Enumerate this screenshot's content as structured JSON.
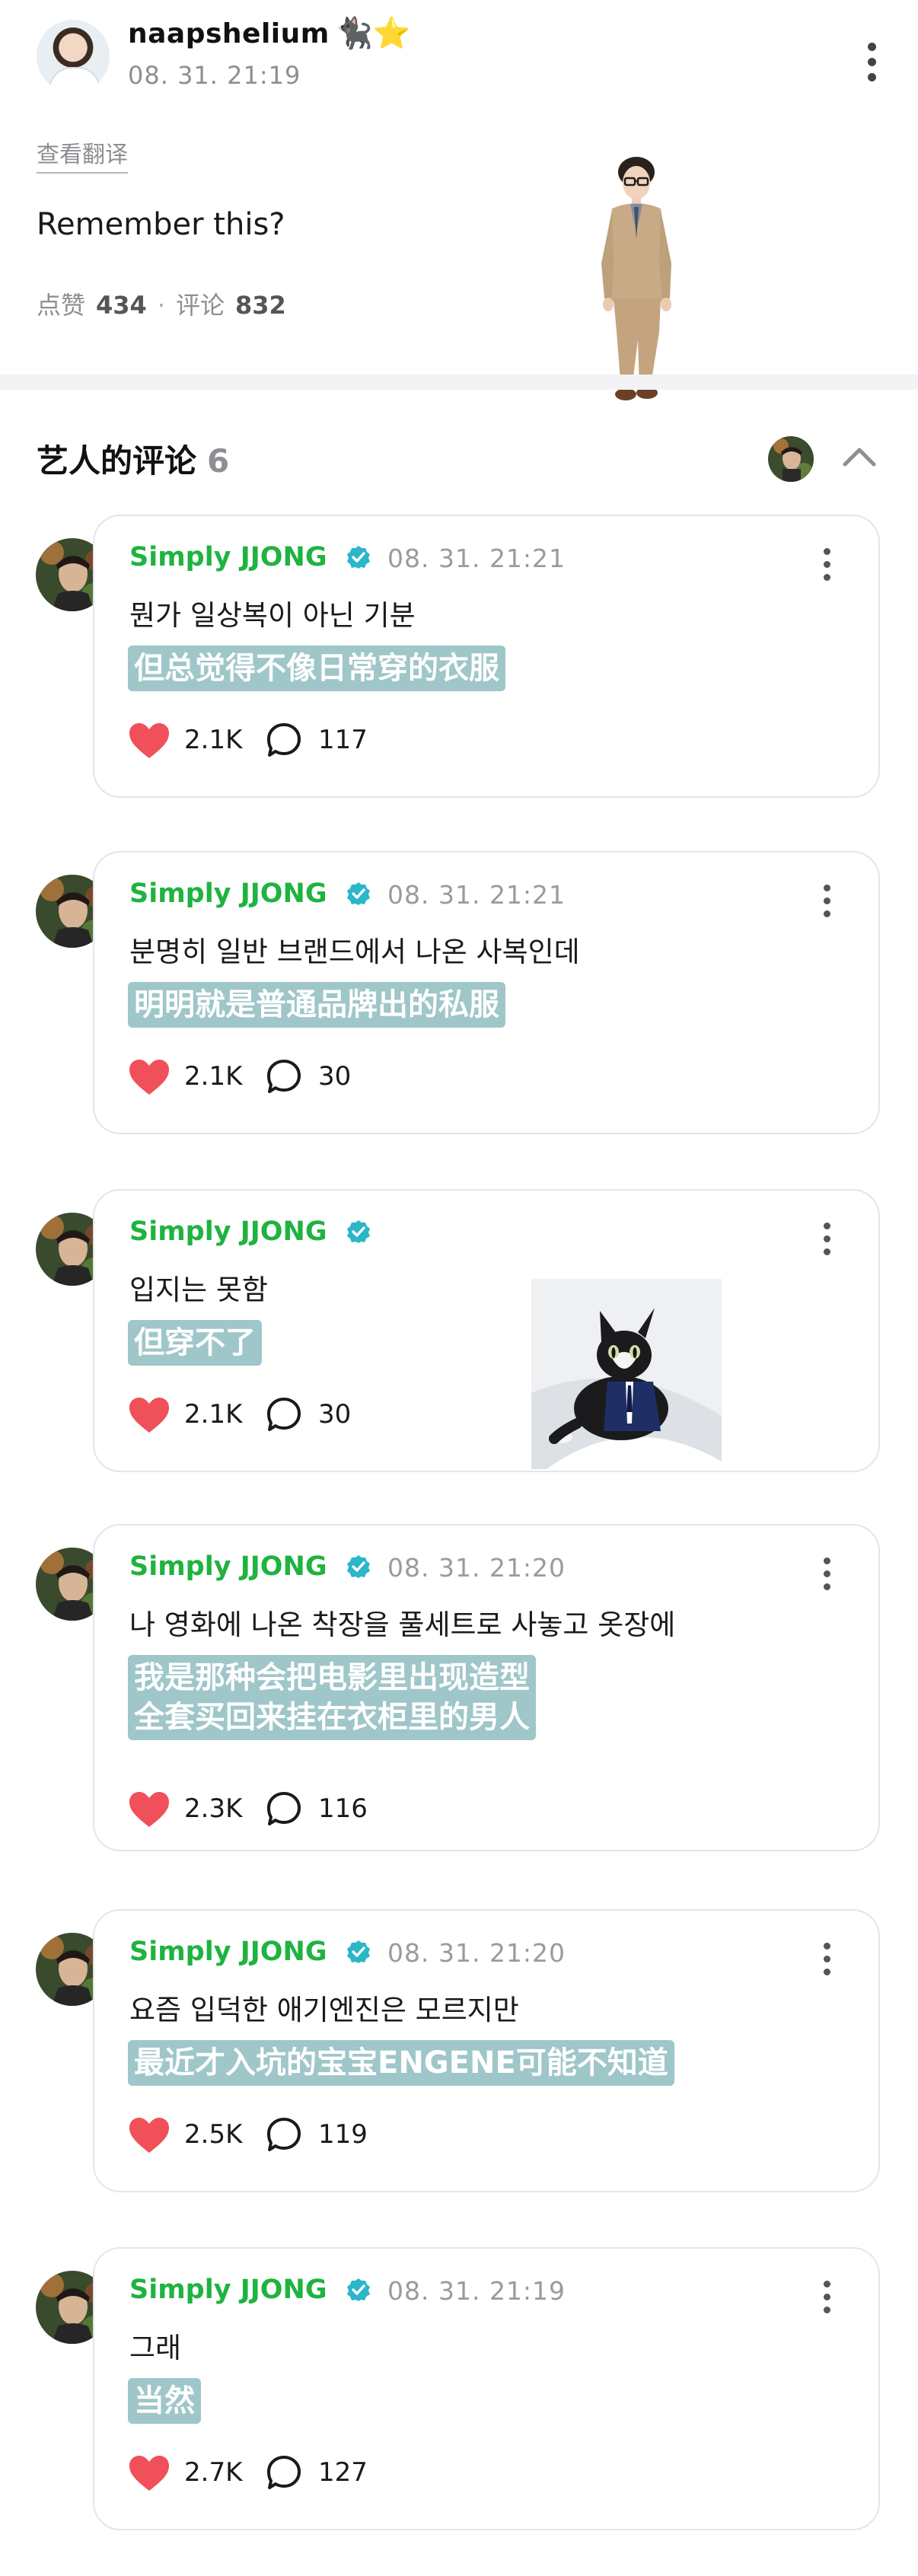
{
  "post": {
    "username": "naapshelium",
    "username_emoji": "🐈‍⬛⭐",
    "timestamp": "08. 31. 21:19",
    "translate_link": "查看翻译",
    "body": "Remember this?",
    "like_label": "点赞",
    "like_count": "434",
    "separator": "·",
    "comment_label": "评论",
    "comment_count": "832"
  },
  "section": {
    "title": "艺人的评论",
    "count": "6"
  },
  "comments": [
    {
      "author": "Simply JJONG",
      "timestamp": "08. 31. 21:21",
      "text": "뭔가 일상복이 아닌 기분",
      "translation": [
        "但总觉得不像日常穿的衣服"
      ],
      "likes": "2.1K",
      "replies": "117"
    },
    {
      "author": "Simply JJONG",
      "timestamp": "08. 31. 21:21",
      "text": "분명히 일반 브랜드에서 나온 사복인데",
      "translation": [
        "明明就是普通品牌出的私服"
      ],
      "likes": "2.1K",
      "replies": "30"
    },
    {
      "author": "Simply JJONG",
      "timestamp": "",
      "text": "입지는 못함",
      "translation": [
        "但穿不了"
      ],
      "likes": "2.1K",
      "replies": "30",
      "has_photo": true
    },
    {
      "author": "Simply JJONG",
      "timestamp": "08. 31. 21:20",
      "text": "나 영화에 나온 착장을 풀세트로 사놓고 옷장에",
      "translation": [
        "我是那种会把电影里出现造型",
        "全套买回来挂在衣柜里的男人"
      ],
      "likes": "2.3K",
      "replies": "116"
    },
    {
      "author": "Simply JJONG",
      "timestamp": "08. 31. 21:20",
      "text": "요즘 입덕한 애기엔진은 모르지만",
      "translation": [
        "最近才入坑的宝宝ENGENE可能不知道"
      ],
      "likes": "2.5K",
      "replies": "119"
    },
    {
      "author": "Simply JJONG",
      "timestamp": "08. 31. 21:19",
      "text": "그래",
      "translation": [
        "当然"
      ],
      "likes": "2.7K",
      "replies": "127"
    }
  ],
  "colors": {
    "author_green": "#1fb33f",
    "verified_teal": "#2bb6c9",
    "translation_bg": "#9fc6c9",
    "heart_red": "#f0505a",
    "muted_gray": "#8e8e93"
  },
  "icons": {
    "more": "kebab-vertical",
    "collapse": "chevron-up",
    "like": "heart-filled",
    "reply": "speech-bubble-outline",
    "verified": "verified-check-badge"
  }
}
